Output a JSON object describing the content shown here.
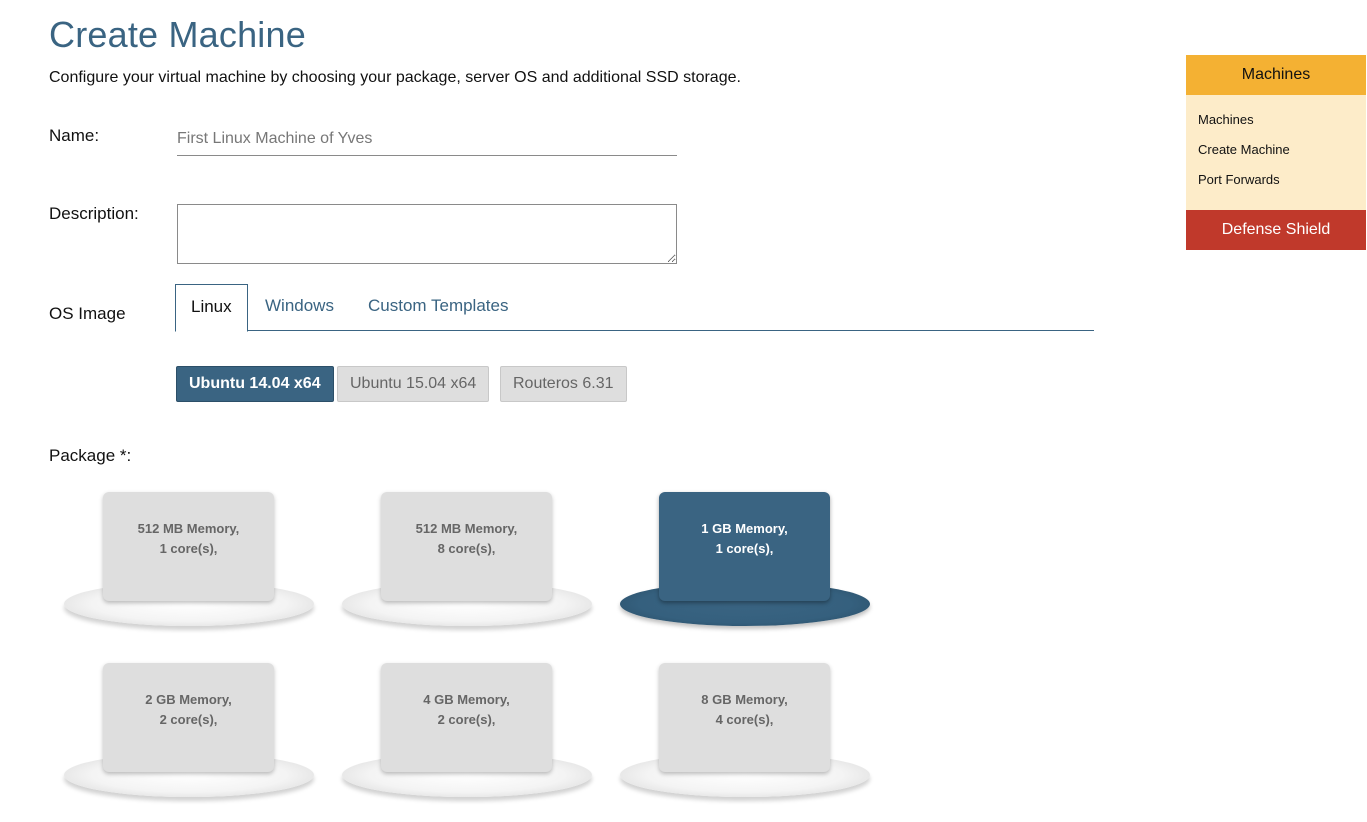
{
  "page": {
    "title": "Create Machine",
    "intro": "Configure your virtual machine by choosing your package, server OS and additional SSD storage."
  },
  "form": {
    "name_label": "Name:",
    "name_placeholder": "First Linux Machine of Yves",
    "name_value": "",
    "description_label": "Description:",
    "description_value": "",
    "os_label": "OS Image",
    "package_label": "Package *:"
  },
  "os_tabs": [
    {
      "label": "Linux",
      "active": true
    },
    {
      "label": "Windows",
      "active": false
    },
    {
      "label": "Custom Templates",
      "active": false
    }
  ],
  "os_images": [
    {
      "label": "Ubuntu 14.04 x64",
      "selected": true
    },
    {
      "label": "Ubuntu 15.04 x64",
      "selected": false
    },
    {
      "label": "Routeros 6.31",
      "selected": false
    }
  ],
  "packages": [
    {
      "memory": "512 MB Memory,",
      "cores": "1 core(s),",
      "selected": false
    },
    {
      "memory": "512 MB Memory,",
      "cores": "8 core(s),",
      "selected": false
    },
    {
      "memory": "1 GB Memory,",
      "cores": "1 core(s),",
      "selected": true
    },
    {
      "memory": "2 GB Memory,",
      "cores": "2 core(s),",
      "selected": false
    },
    {
      "memory": "4 GB Memory,",
      "cores": "2 core(s),",
      "selected": false
    },
    {
      "memory": "8 GB Memory,",
      "cores": "4 core(s),",
      "selected": false
    }
  ],
  "sidebar": {
    "header": "Machines",
    "links": [
      "Machines",
      "Create Machine",
      "Port Forwards"
    ],
    "defense": "Defense Shield"
  },
  "colors": {
    "primary": "#3a6482",
    "sidebar_header": "#f4b133",
    "sidebar_body": "#fdecc9",
    "defense": "#c0392b",
    "unselected": "#dedede"
  }
}
